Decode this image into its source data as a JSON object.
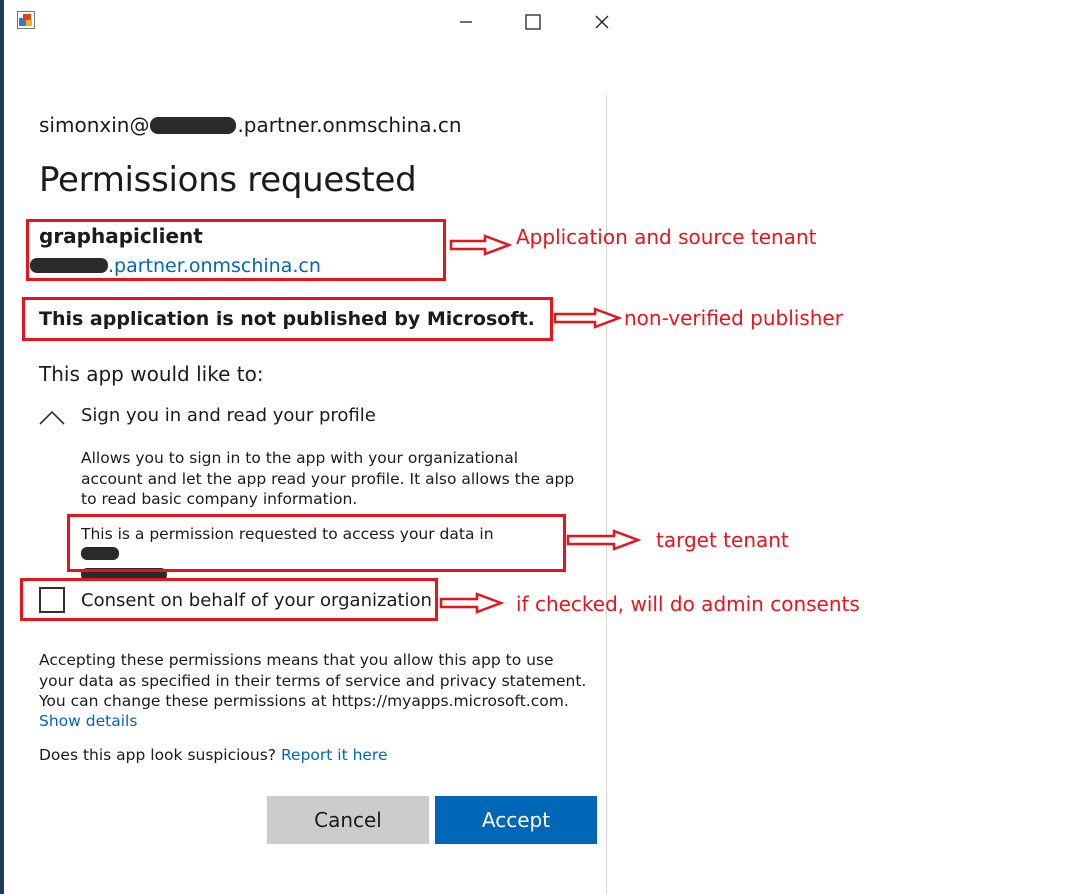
{
  "window": {
    "icon": "app-window-icon",
    "controls": [
      "minimize-icon",
      "maximize-icon",
      "close-icon"
    ]
  },
  "dialog": {
    "account_prefix": "simonxin@",
    "account_suffix": ".partner.onmschina.cn",
    "title": "Permissions requested",
    "app_name": "graphapiclient",
    "app_tenant_suffix": ".partner.onmschina.cn",
    "publisher_notice": "This application is not published by Microsoft.",
    "would_like": "This app would like to:",
    "permission": {
      "title": "Sign you in and read your profile",
      "description_lines": [
        "Allows you to sign in to the app with your organizational",
        "account and let the app read your profile. It also allows the app",
        "to read basic company information."
      ],
      "target_line1": "This is a permission requested to access your data in",
      "target_line1_tail": "",
      "target_line2_tail": "."
    },
    "consent_label": "Consent on behalf of your organization",
    "acceptance_lines": [
      "Accepting these permissions means that you allow this app to use",
      "your data as specified in their terms of service and privacy statement.",
      "You can change these permissions at https://myapps.microsoft.com."
    ],
    "show_details": "Show details",
    "suspicious_question": "Does this app look suspicious?",
    "report_link": "Report it here",
    "cancel_label": "Cancel",
    "accept_label": "Accept"
  },
  "annotations": {
    "app_tenant": "Application and source tenant",
    "publisher": "non-verified publisher",
    "target": "target tenant",
    "consent": "if checked, will do admin consents"
  },
  "colors": {
    "accent": "#0067b8",
    "annotation": "#e8141c",
    "cancel_bg": "#cccccc"
  }
}
